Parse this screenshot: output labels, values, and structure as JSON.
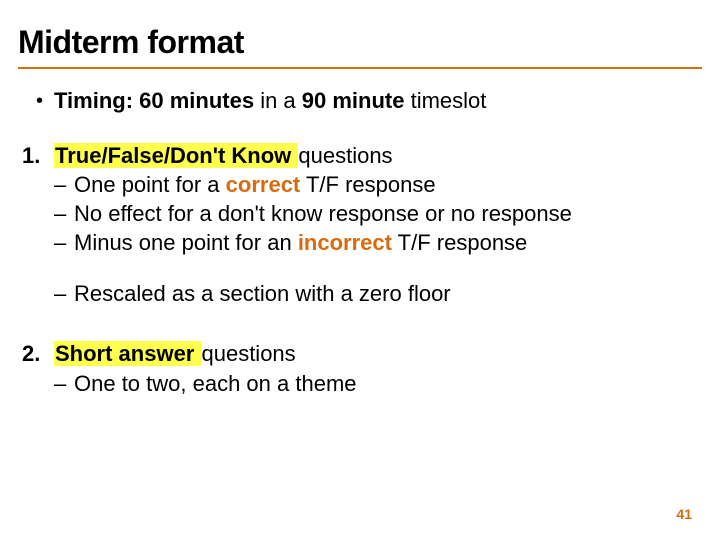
{
  "title": "Midterm format",
  "timing": {
    "prefix": "Timing: 60 minutes",
    "suffix_in_a": " in a ",
    "ninety": "90 minute",
    "tail": " timeslot"
  },
  "item1": {
    "num": "1.",
    "hl": " True/False/Don't Know ",
    "tail": "questions",
    "sub1_a": "One point for a ",
    "sub1_correct": "correct",
    "sub1_b": " T/F response",
    "sub2": "No effect for a don't know response or no response",
    "sub3_a": "Minus one point for an ",
    "sub3_incorrect": "incorrect",
    "sub3_b": " T/F response",
    "sub4": "Rescaled as a section with a zero floor"
  },
  "item2": {
    "num": "2.",
    "hl": " Short answer ",
    "tail": "questions",
    "sub1": "One to two, each on a theme"
  },
  "page": "41"
}
